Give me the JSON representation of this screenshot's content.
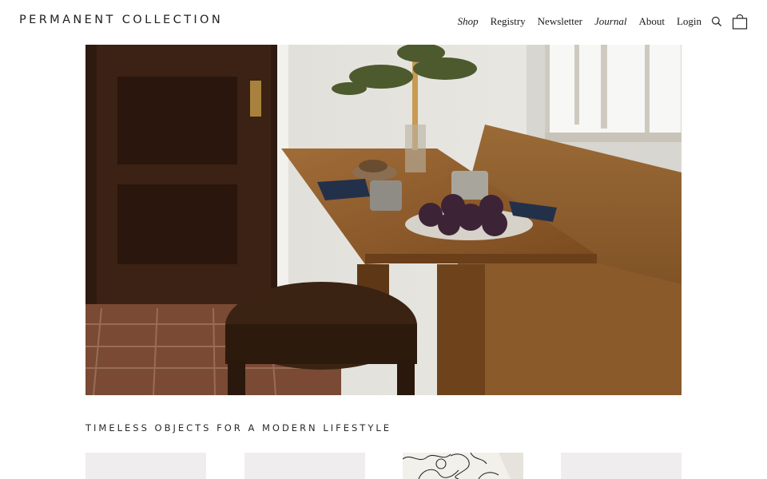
{
  "brand": {
    "name": "PERMANENT COLLECTION"
  },
  "nav": {
    "items": [
      {
        "label": "Shop",
        "italic": true
      },
      {
        "label": "Registry",
        "italic": false
      },
      {
        "label": "Newsletter",
        "italic": false
      },
      {
        "label": "Journal",
        "italic": true
      },
      {
        "label": "About",
        "italic": false
      },
      {
        "label": "Login",
        "italic": false
      }
    ],
    "icons": [
      "search-icon",
      "shopping-bag-icon"
    ]
  },
  "hero": {
    "image": "dining-nook-photo"
  },
  "section": {
    "title": "TIMELESS OBJECTS FOR A MODERN LIFESTYLE"
  },
  "products": [
    {
      "image": "product-thumbnail"
    },
    {
      "image": "product-thumbnail"
    },
    {
      "image": "floral-line-print-thumbnail"
    },
    {
      "image": "product-thumbnail"
    }
  ],
  "colors": {
    "background": "#ffffff",
    "text": "#1a1a1a",
    "thumb_bg": "#efeded"
  }
}
